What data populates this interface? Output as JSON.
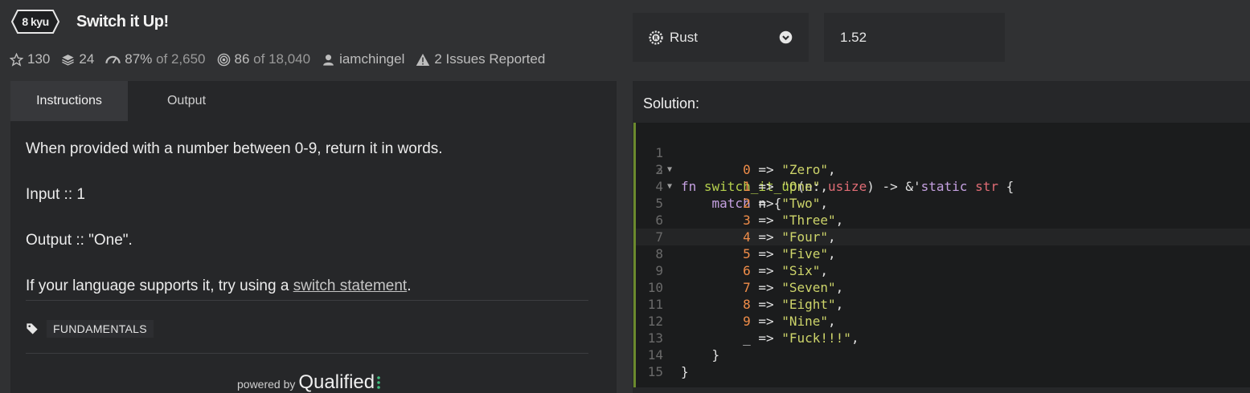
{
  "kata": {
    "rank": "8 kyu",
    "title": "Switch it Up!",
    "stars": "130",
    "collections": "24",
    "satisfaction_pct": "87%",
    "satisfaction_of": "of 2,650",
    "completed": "86",
    "completed_of": "of 18,040",
    "author": "iamchingel",
    "issues": "2 Issues Reported"
  },
  "language": {
    "selected": "Rust",
    "version": "1.52"
  },
  "tabs": [
    {
      "label": "Instructions",
      "active": true
    },
    {
      "label": "Output",
      "active": false
    }
  ],
  "instructions": {
    "line1": "When provided with a number between 0-9, return it in words.",
    "line2": "Input :: 1",
    "line3": "Output :: \"One\".",
    "line4_prefix": "If your language supports it, try using a ",
    "line4_link": "switch statement",
    "line4_suffix": "."
  },
  "tag": "FUNDAMENTALS",
  "powered": {
    "small": "powered by",
    "brand": "Qualified"
  },
  "solution": {
    "label": "Solution:",
    "line_numbers": [
      "1",
      "2",
      "3",
      "4",
      "5",
      "6",
      "7",
      "8",
      "9",
      "10",
      "11",
      "12",
      "13",
      "14",
      "15"
    ],
    "code": {
      "l1": {
        "fn": "fn",
        "name": "switch_it_up",
        "p1": "(n: ",
        "t1": "usize",
        "p2": ") -> &'",
        "kw2": "static",
        "p3": " ",
        "t2": "str",
        "p4": " {"
      },
      "l2": {
        "kw": "match",
        "rest": " n {"
      },
      "arms": [
        {
          "num": "0",
          "arrow": " => ",
          "str": "\"Zero\"",
          "end": ","
        },
        {
          "num": "1",
          "arrow": " => ",
          "str": "\"One\"",
          "end": ","
        },
        {
          "num": "2",
          "arrow": " => ",
          "str": "\"Two\"",
          "end": ","
        },
        {
          "num": "3",
          "arrow": " => ",
          "str": "\"Three\"",
          "end": ","
        },
        {
          "num": "4",
          "arrow": " => ",
          "str": "\"Four\"",
          "end": ","
        },
        {
          "num": "5",
          "arrow": " => ",
          "str": "\"Five\"",
          "end": ","
        },
        {
          "num": "6",
          "arrow": " => ",
          "str": "\"Six\"",
          "end": ","
        },
        {
          "num": "7",
          "arrow": " => ",
          "str": "\"Seven\"",
          "end": ","
        },
        {
          "num": "8",
          "arrow": " => ",
          "str": "\"Eight\"",
          "end": ","
        },
        {
          "num": "9",
          "arrow": " => ",
          "str": "\"Nine\"",
          "end": ","
        }
      ],
      "l13": {
        "pre": "_",
        "arrow": " => ",
        "str": "\"Fuck!!!\"",
        "end": ","
      },
      "l14": "}",
      "l15": "}"
    }
  },
  "colors": {
    "accent_bar": "#6b8a2d",
    "keyword": "#c4a0e0",
    "function": "#b5d04d",
    "type": "#e06c75",
    "number": "#f08d49",
    "string": "#cdd46a"
  }
}
